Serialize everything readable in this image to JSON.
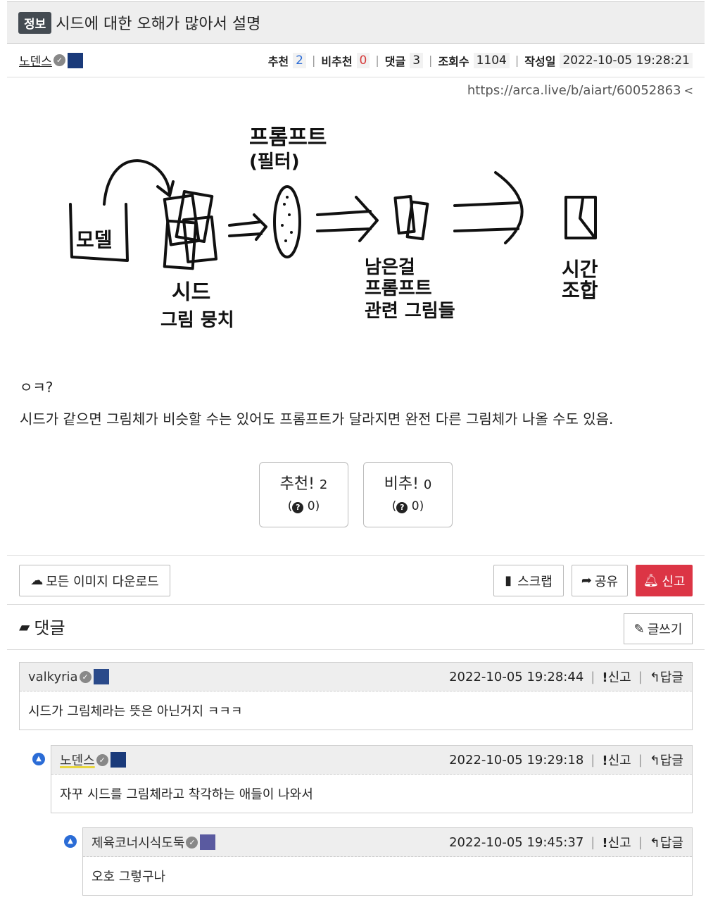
{
  "post": {
    "badge": "정보",
    "title": "시드에 대한 오해가 많아서 설명",
    "author": "노덴스",
    "stats": {
      "recommend_label": "추천",
      "recommend": "2",
      "unrecommend_label": "비추천",
      "unrecommend": "0",
      "comments_label": "댓글",
      "comments": "3",
      "views_label": "조회수",
      "views": "1104",
      "date_label": "작성일",
      "date": "2022-10-05 19:28:21"
    },
    "url": "https://arca.live/b/aiart/60052863",
    "drawing": {
      "model": "모델",
      "seed": "시드",
      "seed_sub": "그림 뭉치",
      "prompt": "프롬프트",
      "filter": "(필터)",
      "remain1": "남은걸",
      "remain2": "프롬프트",
      "remain3": "관련 그림들",
      "random1": "시간",
      "random2": "조합"
    },
    "body_lines": [
      "ㅇㅋ?",
      "시드가 같으면 그림체가 비슷할 수는 있어도 프롬프트가 달라지면 완전 다른 그림체가 나올 수도 있음."
    ]
  },
  "votes": {
    "up_label": "추천!",
    "up_count": "2",
    "up_sub": "0",
    "down_label": "비추!",
    "down_count": "0",
    "down_sub": "0"
  },
  "actions": {
    "download_all": "모든 이미지 다운로드",
    "scrap": "스크랩",
    "share": "공유",
    "report": "신고"
  },
  "comments_section": {
    "title": "댓글",
    "write": "글쓰기",
    "report": "신고",
    "reply": "답글",
    "items": [
      {
        "author": "valkyria",
        "date": "2022-10-05 19:28:44",
        "text": "시드가 그림체라는 뜻은 아닌거지 ㅋㅋㅋ"
      },
      {
        "author": "노덴스",
        "date": "2022-10-05 19:29:18",
        "text": "자꾸 시드를 그림체라고 착각하는 애들이 나와서"
      },
      {
        "author": "제육코너시식도둑",
        "date": "2022-10-05 19:45:37",
        "text": "오호 그렇구나"
      }
    ]
  }
}
